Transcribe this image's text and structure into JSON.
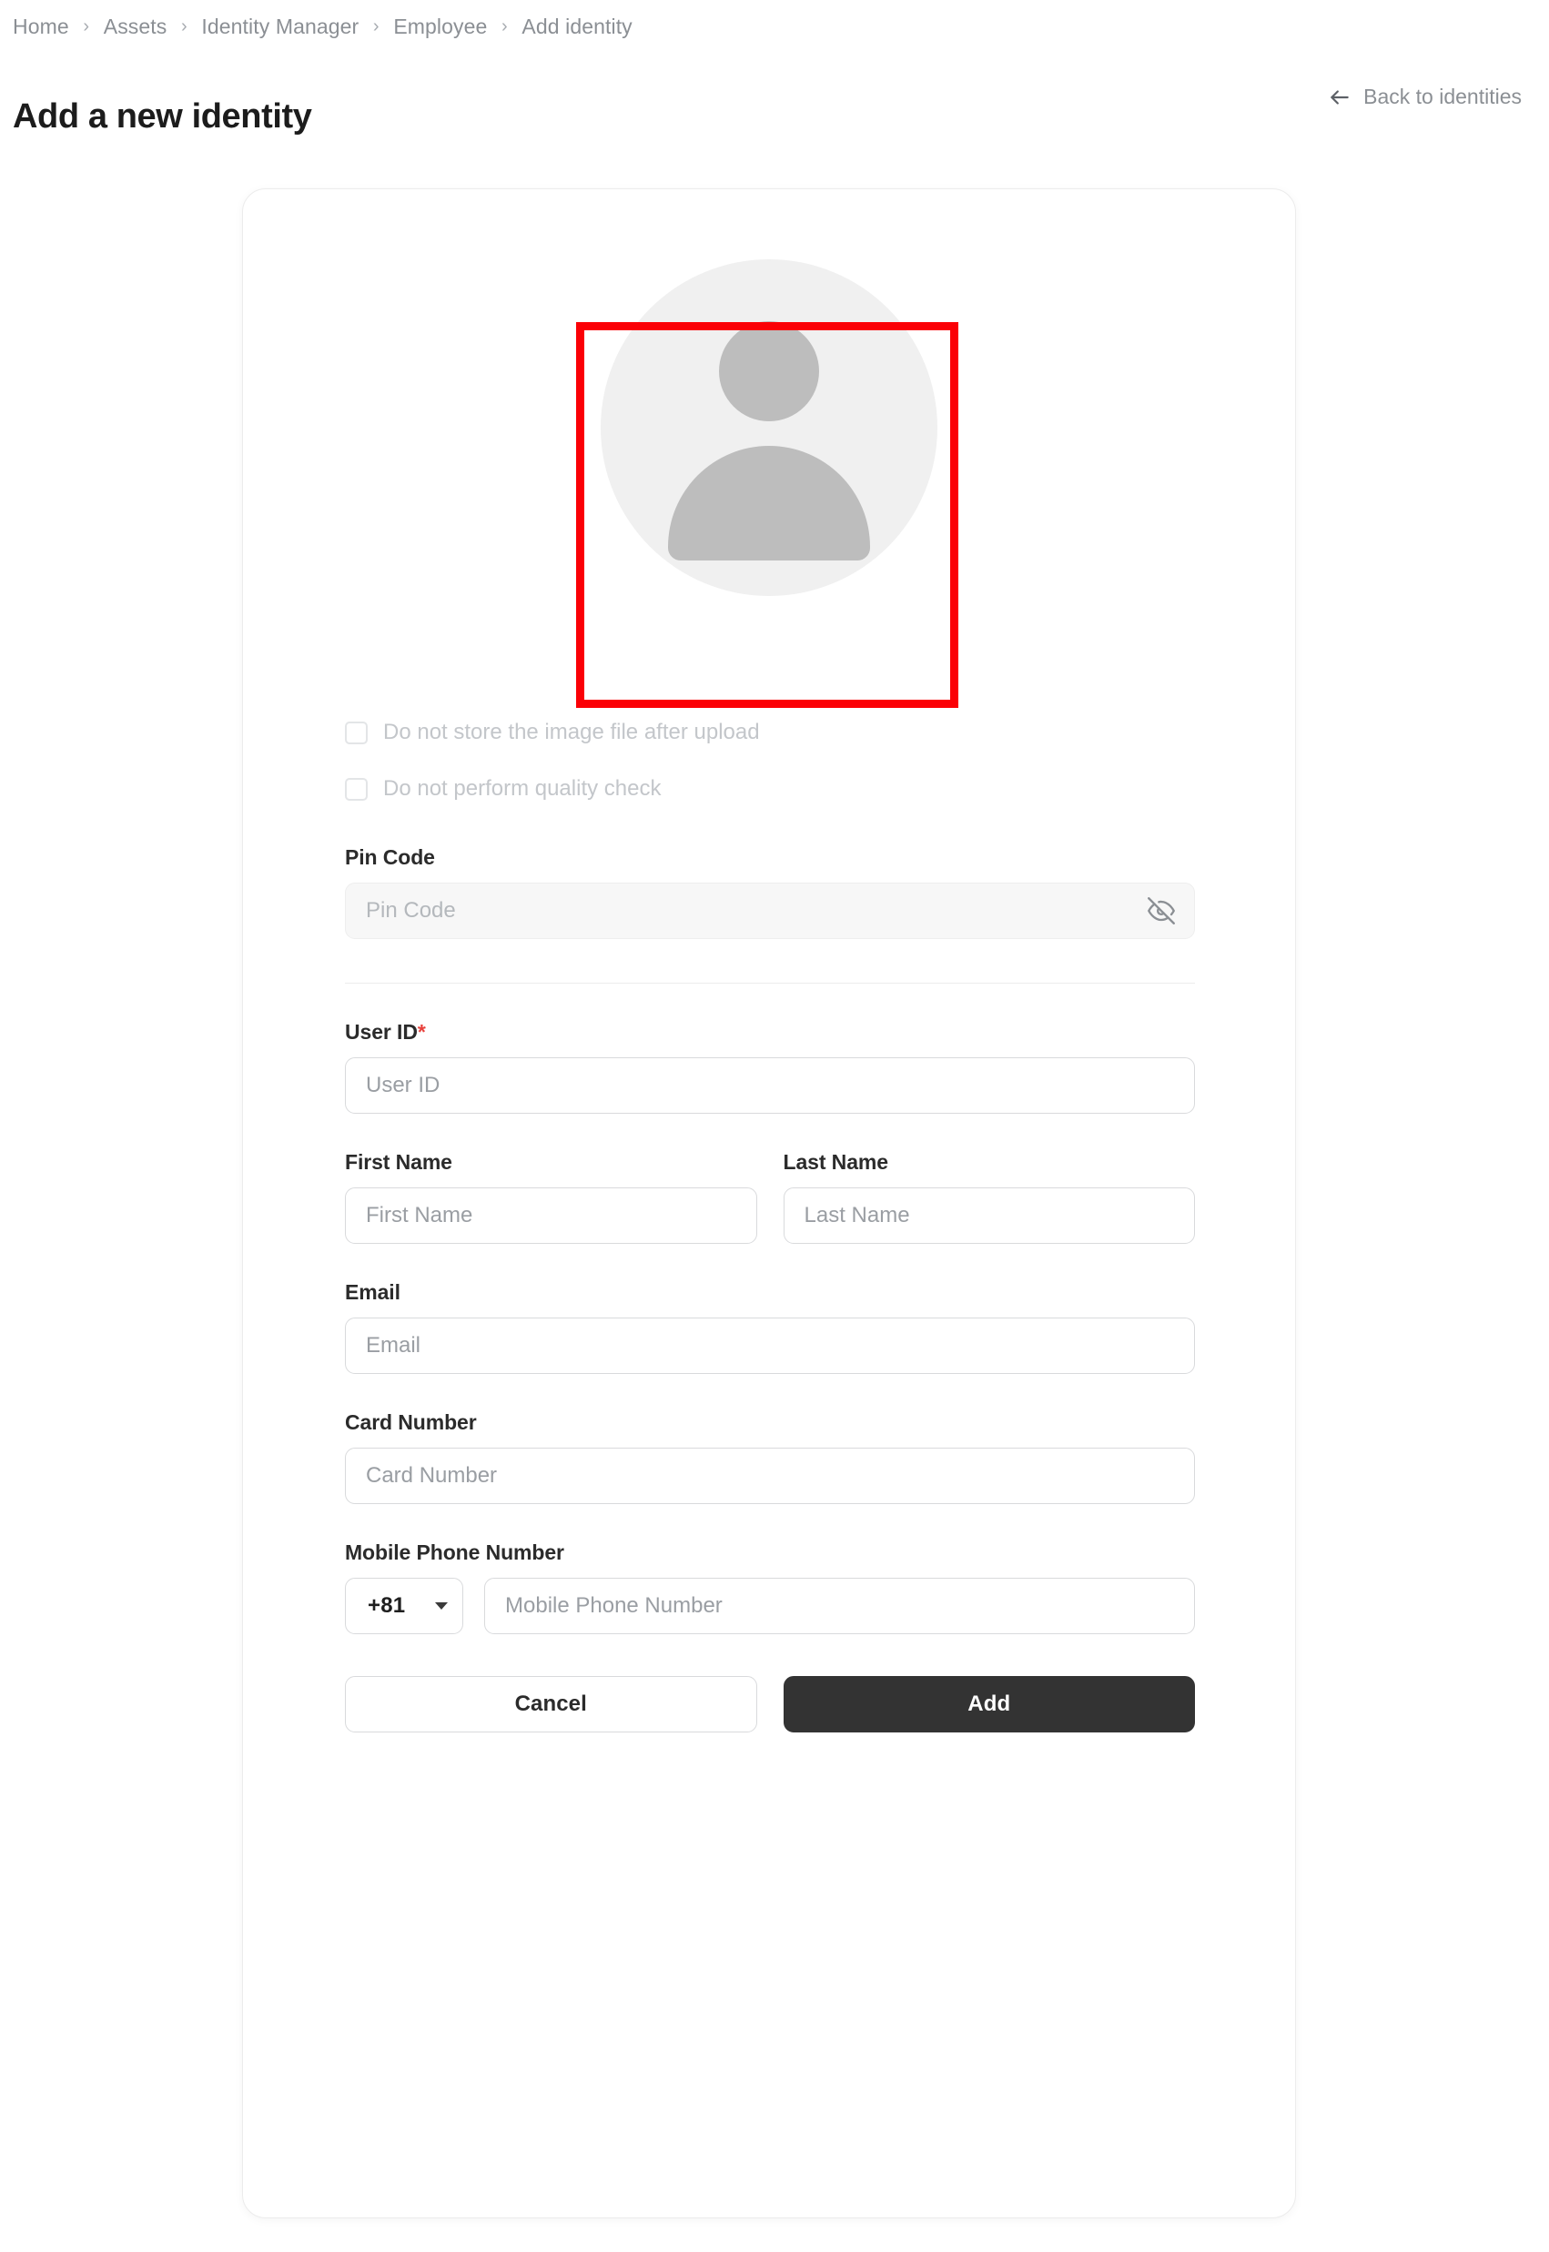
{
  "breadcrumb": {
    "separator": "›",
    "items": [
      {
        "label": "Home"
      },
      {
        "label": "Assets"
      },
      {
        "label": "Identity Manager"
      },
      {
        "label": "Employee"
      },
      {
        "label": "Add identity"
      }
    ]
  },
  "header": {
    "title": "Add a new identity",
    "back_link": "Back to identities",
    "back_icon": "arrow-left-icon"
  },
  "avatar": {
    "icon": "person-placeholder-icon",
    "highlight_color": "#fb0006",
    "circle_color": "#f0f0f0",
    "figure_color": "#bdbdbd"
  },
  "options": [
    {
      "label": "Do not store the image file after upload",
      "checked": false,
      "disabled": true
    },
    {
      "label": "Do not perform quality check",
      "checked": false,
      "disabled": true
    }
  ],
  "fields": {
    "pin_code": {
      "label": "Pin Code",
      "placeholder": "Pin Code",
      "value": "",
      "disabled": true,
      "toggle_icon": "eye-off-icon"
    },
    "user_id": {
      "label": "User ID",
      "required_marker": "*",
      "placeholder": "User ID",
      "value": ""
    },
    "first_name": {
      "label": "First Name",
      "placeholder": "First Name",
      "value": ""
    },
    "last_name": {
      "label": "Last Name",
      "placeholder": "Last Name",
      "value": ""
    },
    "email": {
      "label": "Email",
      "placeholder": "Email",
      "value": ""
    },
    "card_number": {
      "label": "Card Number",
      "placeholder": "Card Number",
      "value": ""
    },
    "mobile_phone": {
      "label": "Mobile Phone Number",
      "country_code": "+81",
      "placeholder": "Mobile Phone Number",
      "value": ""
    }
  },
  "actions": {
    "cancel_label": "Cancel",
    "add_label": "Add"
  },
  "colors": {
    "primary_button": "#333333",
    "required_star": "#e8413c",
    "highlight_box": "#fb0006",
    "muted_text": "#8b8f94"
  }
}
